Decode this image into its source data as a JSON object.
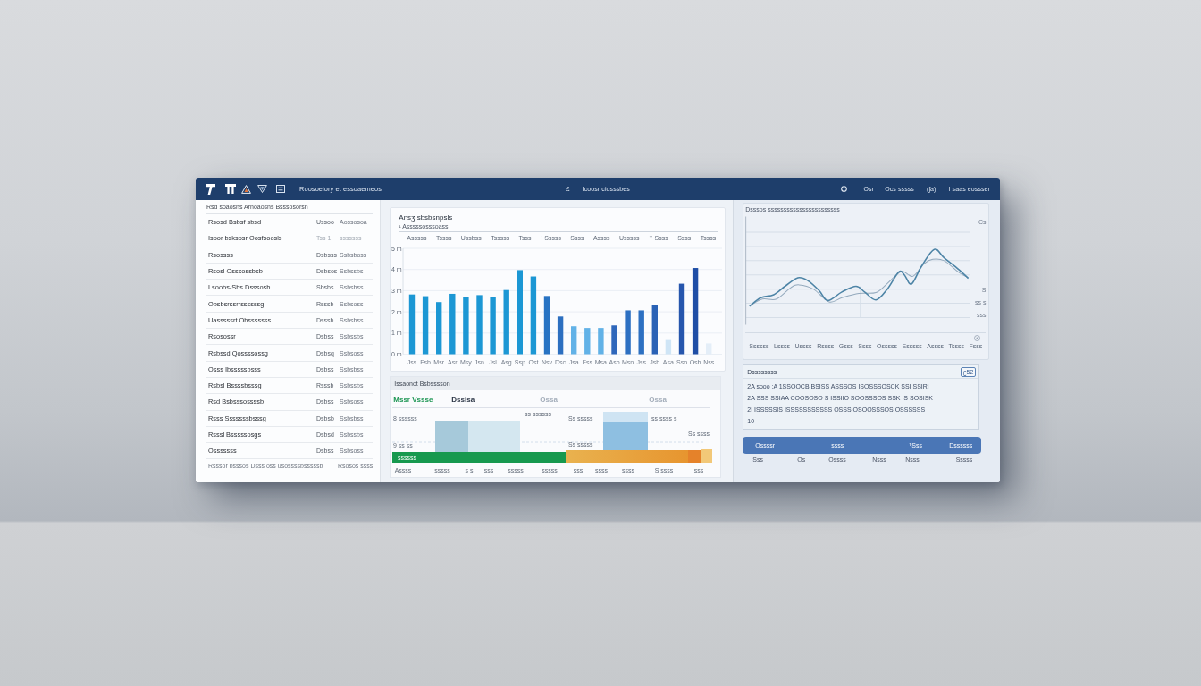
{
  "title_bar": {
    "title": "Roosoeiory et essoaemeos",
    "center_mark": "£",
    "center_label": "Icoosr ciosssbes",
    "right_labels": [
      "Osr",
      "Ocs sssss",
      "(ʃa)",
      "I saas eossser"
    ]
  },
  "list": {
    "header": "Rsd soaosns Arnoaosns Bsssosorsn",
    "rows": [
      {
        "name": "Rsosd Bsbsf sbsd",
        "code": "Ussoo",
        "value": "Aossosoa",
        "muted": false
      },
      {
        "name": "Isoor bsksosr Oosfsoosls",
        "code": "Tss 1",
        "value": "sssssss",
        "muted": true
      },
      {
        "name": "Rsossss",
        "code": "Dsbsss",
        "value": "Ssbsboss",
        "muted": false
      },
      {
        "name": "Rsosl Osssossbsb",
        "code": "Dsbsos",
        "value": "Ssbssbs",
        "muted": false
      },
      {
        "name": "Lsoobs-Sbs Dsssosb",
        "code": "Sbsbs",
        "value": "Ssbsbss",
        "muted": false
      },
      {
        "name": "Obsbsrssrrssssssg",
        "code": "Rsssb",
        "value": "Ssbsoss",
        "muted": false
      },
      {
        "name": "Uasssssrt Obsssssss",
        "code": "Dsssb",
        "value": "Ssbsbss",
        "muted": false
      },
      {
        "name": "Rsosossr",
        "code": "Dsbss",
        "value": "Ssbssbs",
        "muted": false
      },
      {
        "name": "Rsbssd Qossssossg",
        "code": "Dsbsq",
        "value": "Ssbsoss",
        "muted": false
      },
      {
        "name": "Osss Ibsssssbsss",
        "code": "Dsbss",
        "value": "Ssbsbss",
        "muted": false
      },
      {
        "name": "Rsbsl Bssssbsssg",
        "code": "Rsssb",
        "value": "Ssbssbs",
        "muted": false
      },
      {
        "name": "Rsd Bsbsssossssb",
        "code": "Dsbss",
        "value": "Ssbsoss",
        "muted": false
      },
      {
        "name": "Rsss Sssssssbsssg",
        "code": "Dsbsb",
        "value": "Ssbsbss",
        "muted": false
      },
      {
        "name": "Rsssl Bsssssosgs",
        "code": "Dsbsd",
        "value": "Ssbssbs",
        "muted": false
      },
      {
        "name": "Osssssss",
        "code": "Dsbss",
        "value": "Ssbsoss",
        "muted": false
      }
    ],
    "footer": {
      "text": "Rsssor bsssos Dsss oss usossssbsssssb",
      "value": "Rsosos ssss"
    }
  },
  "bar_panel": {
    "title": "Ansʒ sbsbsnpsls",
    "subtitle": "¹ Asssssosssoass",
    "column_labels": [
      "Asssss",
      "Tssss",
      "Ussbss",
      "Tsssss",
      "Tsss",
      "ˈ Sssss",
      "Ssss",
      "Assss",
      "Usssss",
      "ˈˈ Ssss",
      "Ssss",
      "Tssss"
    ],
    "chart_data": {
      "type": "bar",
      "categories": [
        "Jss",
        "Fsb",
        "Msr",
        "Asr",
        "Msy",
        "Jsn",
        "Jsl",
        "Asg",
        "Ssp",
        "Ost",
        "Nsv",
        "Dsc",
        "Jsa",
        "Fss",
        "Msa",
        "Asb",
        "Msn",
        "Jss",
        "Jsb",
        "Asa",
        "Ssn",
        "Osb",
        "Nss"
      ],
      "values": [
        2.82,
        2.74,
        2.46,
        2.85,
        2.71,
        2.79,
        2.71,
        3.03,
        3.97,
        3.67,
        2.75,
        1.78,
        1.32,
        1.24,
        1.24,
        1.36,
        2.07,
        2.07,
        2.31,
        0.67,
        3.33,
        4.07,
        0.51
      ],
      "colors": [
        "#1c97d4",
        "#1c97d4",
        "#1c97d4",
        "#1c97d4",
        "#1c97d4",
        "#1c97d4",
        "#1c97d4",
        "#1c97d4",
        "#1c97d4",
        "#1c97d4",
        "#2873c3",
        "#2c6fc0",
        "#62b2e7",
        "#62b2e7",
        "#62b2e7",
        "#2f67bb",
        "#2d70c2",
        "#2d70c2",
        "#2a62b6",
        "#cfe5f6",
        "#2656ad",
        "#1f4ea6",
        "#e4eef8"
      ],
      "ylim": [
        0,
        5
      ],
      "yticks": [
        {
          "value": 0,
          "label": "0 m"
        },
        {
          "value": 1,
          "label": "1 m"
        },
        {
          "value": 2,
          "label": "2 m"
        },
        {
          "value": 3,
          "label": "3 m"
        },
        {
          "value": 4,
          "label": "4 m"
        },
        {
          "value": 5,
          "label": "5 m"
        }
      ],
      "grid": true
    }
  },
  "range_panel": {
    "header": "Issaonot Bsbsssson",
    "legend": [
      {
        "text": "Mssr Vssse",
        "color": "#1b9552"
      },
      {
        "text": "Dssisa",
        "color": "#2c3646"
      },
      {
        "text": "Ossa",
        "color": "#a3adba"
      },
      {
        "text": "Ossa",
        "color": "#a3adba"
      }
    ],
    "y_labels": [
      "8 ssssss",
      "9 ss ss"
    ],
    "annotations": [
      "ss ssssss",
      "Ss sssss",
      "ss ssss s",
      "Ss ssss",
      "Ss sssss"
    ],
    "bar_label": "ssssss",
    "x_labels": [
      "Assss",
      "sssss",
      "s s",
      "sss",
      "sssss",
      "sssss",
      "sss",
      "ssss",
      "ssss",
      "S ssss",
      "sss"
    ]
  },
  "line_panel": {
    "title": "Dsssos sssssssssssssssssssssss",
    "side_labels": [
      "Cs",
      "S",
      "ss s",
      "sss"
    ],
    "x_labels": [
      "Ssssss",
      "Lssss",
      "Ussss",
      "Rssss",
      "Gsss",
      "Ssss",
      "Osssss",
      "Esssss",
      "Assss",
      "Tssss",
      "Fsss"
    ]
  },
  "notes": {
    "title": "Dssssssss",
    "badge": "ʗ52",
    "lines": [
      "2A sooo :A 1SSOOCB BSISS  ASSSOS ISOSSSOSCK SSI SSIRI",
      "2A SSS SSIAA COOSOSO S ISSIIO SOOSSSOS SSK IS SOSISK",
      "2I   ISSSSSIS ISSSSSSSSSSS OSSS OSOOSSSOS OSSSSSS",
      "10"
    ]
  },
  "summary_bar": {
    "labels": [
      "Ossssr",
      "ssss",
      "ᵀSss",
      "Dssssss"
    ]
  },
  "summary_row": {
    "items": [
      "Sss",
      "Os",
      "Ossss",
      "Nsss",
      "Nsss",
      "Sssss"
    ]
  }
}
